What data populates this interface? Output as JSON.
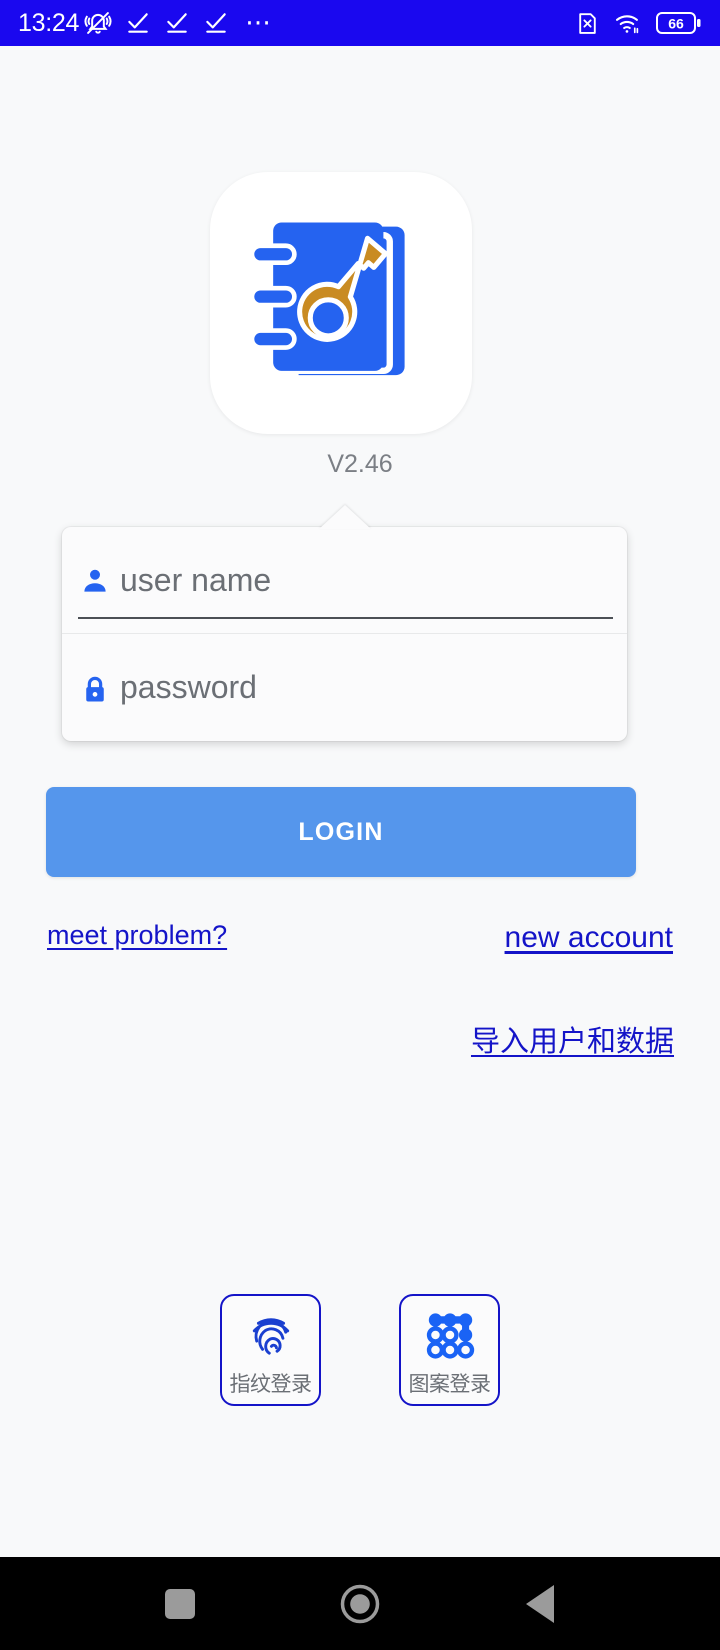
{
  "status_bar": {
    "time": "13:24",
    "left_icons": [
      "bell-muted-icon",
      "task-check-icon",
      "task-check-icon",
      "task-check-icon",
      "more-dots-icon"
    ],
    "right_icons": [
      "sim-no-service-icon",
      "wifi-icon"
    ],
    "battery_level": "66",
    "background_color": "#1a08ef"
  },
  "app": {
    "icon_name": "notebook-key-app-icon",
    "version": "V2.46"
  },
  "login_card": {
    "username": {
      "icon": "person-icon",
      "placeholder": "user name",
      "value": ""
    },
    "password": {
      "icon": "lock-icon",
      "placeholder": "password",
      "value": ""
    }
  },
  "buttons": {
    "login_label": "LOGIN",
    "login_color": "#5596ec"
  },
  "links": {
    "meet_problem": "meet problem?",
    "new_account": "new account",
    "import_user_data": "导入用户和数据",
    "color": "#1414c8"
  },
  "biometric": [
    {
      "icon": "fingerprint-icon",
      "label": "指纹登录"
    },
    {
      "icon": "pattern-lock-icon",
      "label": "图案登录"
    }
  ],
  "nav_bar": {
    "recents": "recents-square-icon",
    "home": "home-circle-icon",
    "back": "back-triangle-icon"
  }
}
